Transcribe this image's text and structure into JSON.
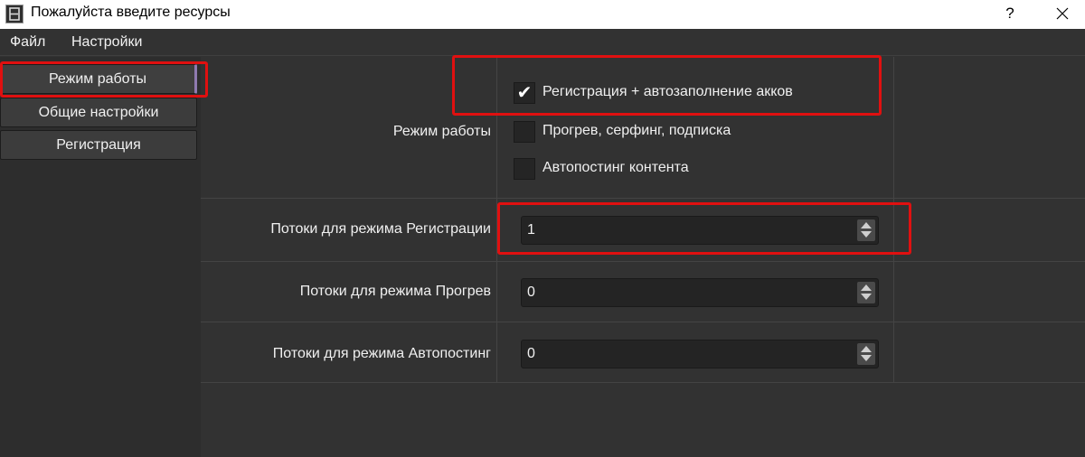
{
  "window": {
    "title": "Пожалуйста введите ресурсы",
    "help_label": "?",
    "accent_highlight": "#e01010"
  },
  "menu": {
    "items": [
      {
        "label": "Файл"
      },
      {
        "label": "Настройки"
      }
    ]
  },
  "sidebar": {
    "items": [
      {
        "label": "Режим работы",
        "active": true
      },
      {
        "label": "Общие настройки",
        "active": false
      },
      {
        "label": "Регистрация",
        "active": false
      }
    ]
  },
  "form": {
    "mode": {
      "label": "Режим работы",
      "options": [
        {
          "label": "Регистрация + автозаполнение акков",
          "checked": true,
          "check_glyph": "✔"
        },
        {
          "label": "Прогрев, серфинг, подписка",
          "checked": false,
          "check_glyph": ""
        },
        {
          "label": "Автопостинг контента",
          "checked": false,
          "check_glyph": ""
        }
      ]
    },
    "threads": [
      {
        "label": "Потоки для режима Регистрации",
        "value": "1"
      },
      {
        "label": "Потоки для режима Прогрев",
        "value": "0"
      },
      {
        "label": "Потоки для режима Автопостинг",
        "value": "0"
      }
    ]
  }
}
